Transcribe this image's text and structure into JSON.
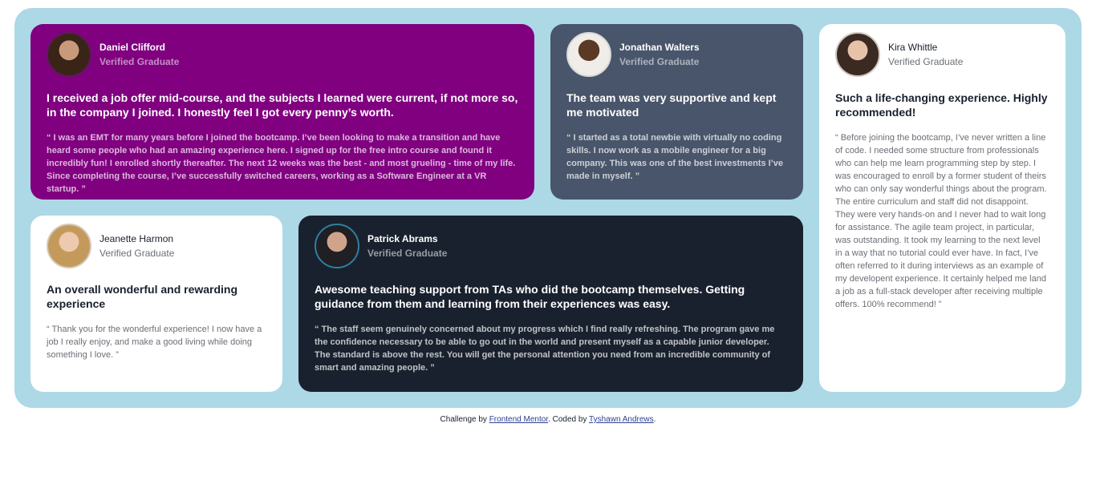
{
  "testimonials": [
    {
      "name": "Daniel Clifford",
      "role": "Verified Graduate",
      "avatar_icon": "avatar-daniel",
      "headline": "I received a job offer mid-course, and the subjects I learned were current, if not more so, in the company I joined. I honestly feel I got every penny’s worth.",
      "quote": "“ I was an EMT for many years before I joined the bootcamp. I’ve been looking to make a transition and have heard some people who had an amazing experience here. I signed up for the free intro course and found it incredibly fun! I enrolled shortly thereafter. The next 12 weeks was the best - and most grueling - time of my life. Since completing the course, I’ve successfully switched careers, working as a Software Engineer at a VR startup. ”",
      "color": "#800080"
    },
    {
      "name": "Jonathan Walters",
      "role": "Verified Graduate",
      "avatar_icon": "avatar-jonathan",
      "headline": "The team was very supportive and kept me motivated",
      "quote": "“ I started as a total newbie with virtually no coding skills. I now work as a mobile engineer for a big company. This was one of the best investments I’ve made in myself. ”",
      "color": "#48556a"
    },
    {
      "name": "Kira Whittle",
      "role": "Verified Graduate",
      "avatar_icon": "avatar-kira",
      "headline": "Such a life-changing experience. Highly recommended!",
      "quote": "“ Before joining the bootcamp, I’ve never written a line of code. I needed some structure from professionals who can help me learn programming step by step. I was encouraged to enroll by a former student of theirs who can only say wonderful things about the program. The entire curriculum and staff did not disappoint. They were very hands-on and I never had to wait long for assistance. The agile team project, in particular, was outstanding. It took my learning to the next level in a way that no tutorial could ever have. In fact, I’ve often referred to it during interviews as an example of my developent experience. It certainly helped me land a job as a full-stack developer after receiving multiple offers. 100% recommend! ”",
      "color": "#ffffff"
    },
    {
      "name": "Jeanette Harmon",
      "role": "Verified Graduate",
      "avatar_icon": "avatar-jeanette",
      "headline": "An overall wonderful and rewarding experience",
      "quote": "“ Thank you for the wonderful experience! I now have a job I really enjoy, and make a good living while doing something I love. ”",
      "color": "#ffffff"
    },
    {
      "name": "Patrick Abrams",
      "role": "Verified Graduate",
      "avatar_icon": "avatar-patrick",
      "headline": "Awesome teaching support from TAs who did the bootcamp themselves. Getting guidance from them and learning from their experiences was easy.",
      "quote": "“ The staff seem genuinely concerned about my progress which I find really refreshing. The program gave me the confidence necessary to be able to go out in the world and present myself as a capable junior developer. The standard is above the rest. You will get the personal attention you need from an incredible community of smart and amazing people. ”",
      "color": "#19212e"
    }
  ],
  "footer": {
    "prefix": "Challenge by ",
    "link1": "Frontend Mentor",
    "middle": ". Coded by ",
    "link2": "Tyshawn Andrews",
    "suffix": "."
  },
  "colors": {
    "board": "#add8e6",
    "purple": "#800080",
    "slate": "#48556a",
    "dark": "#19212e"
  }
}
